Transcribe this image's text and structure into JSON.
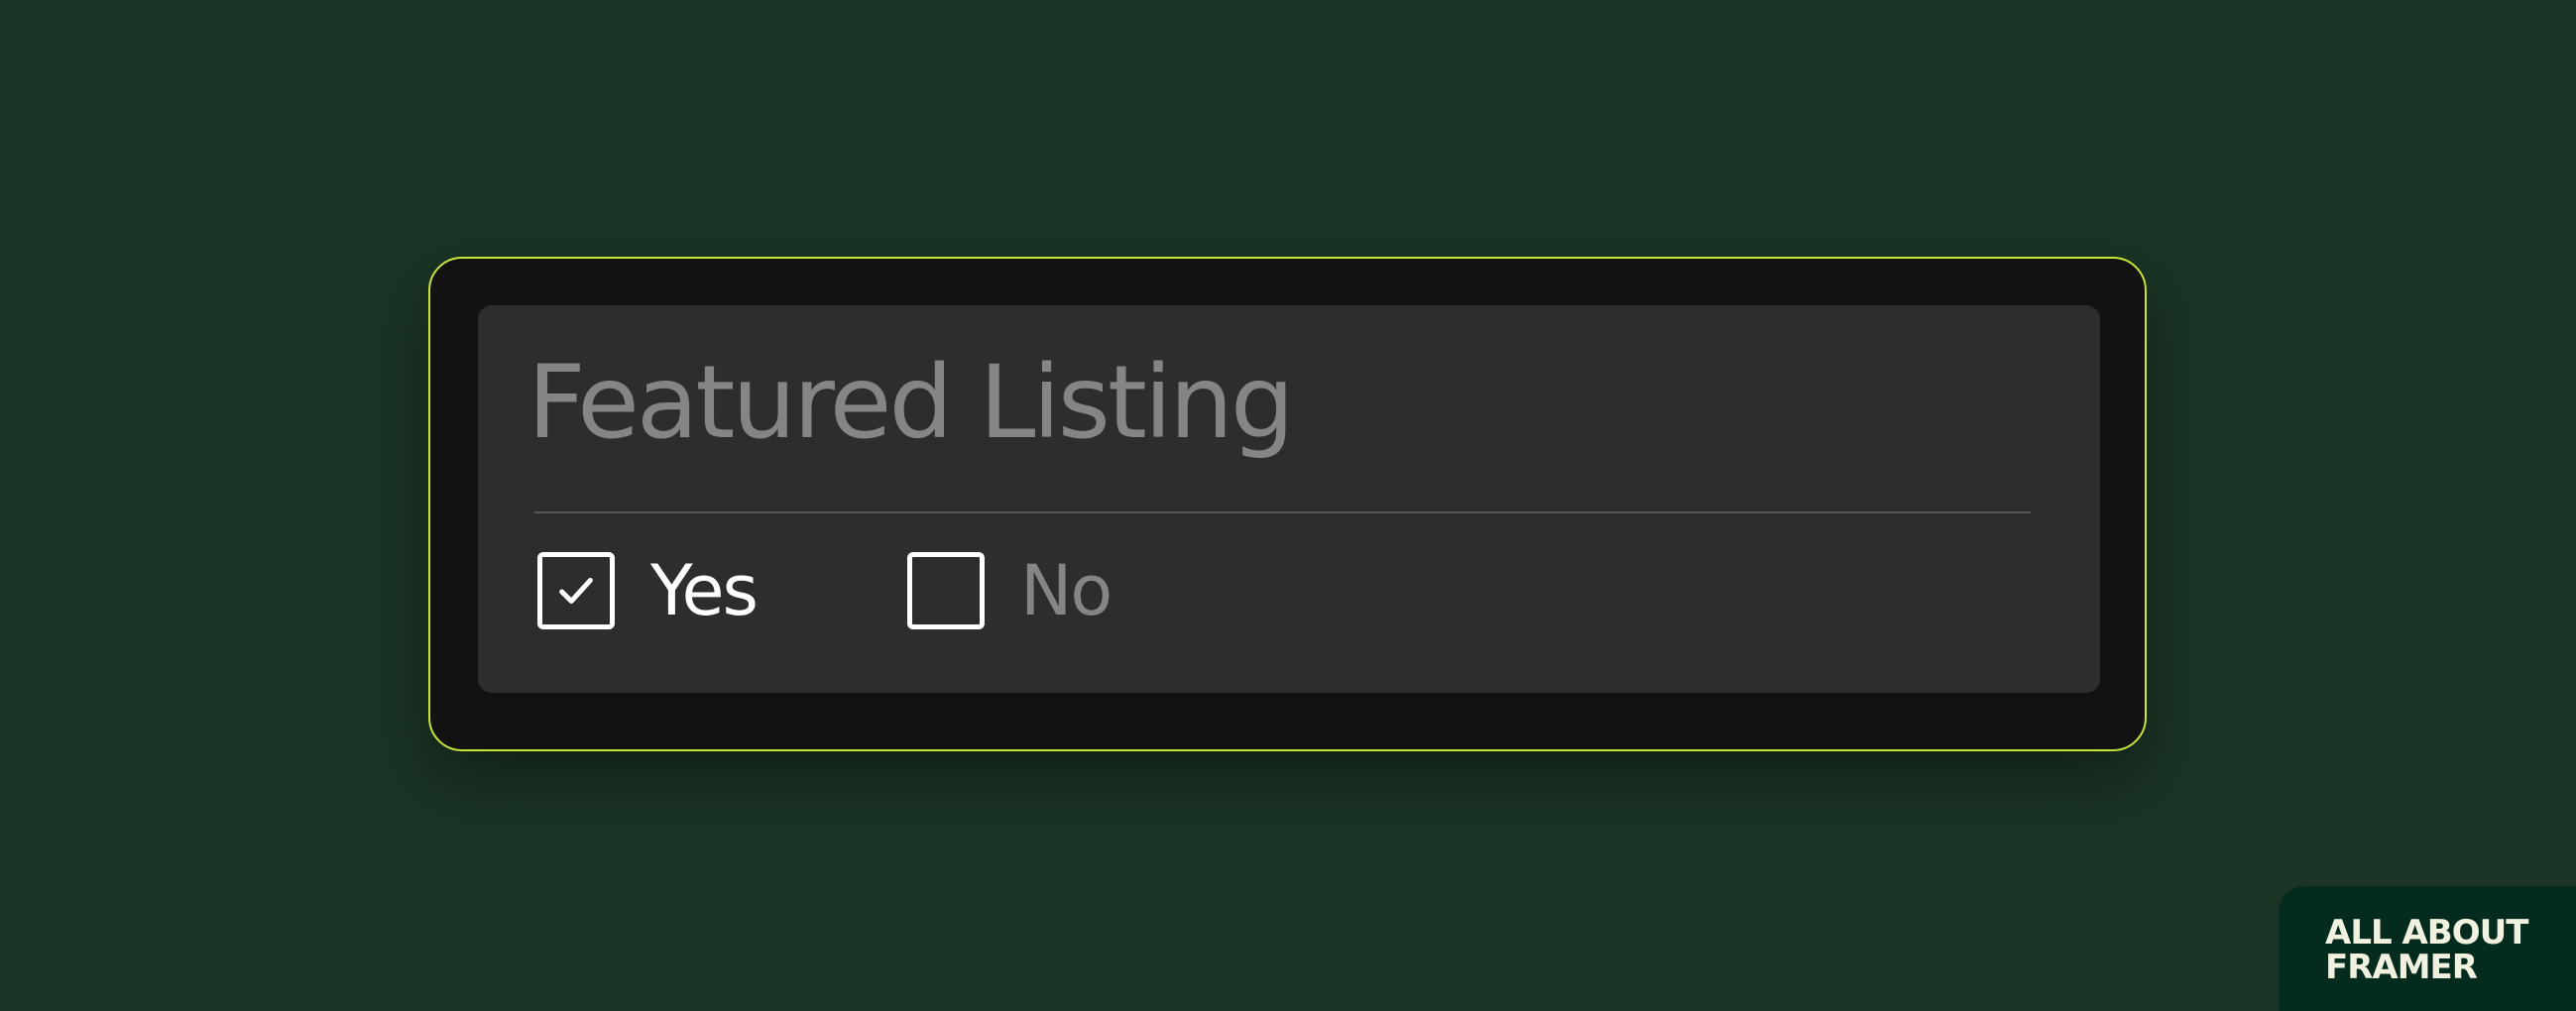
{
  "field": {
    "title": "Featured Listing",
    "options": [
      {
        "label": "Yes",
        "checked": true
      },
      {
        "label": "No",
        "checked": false
      }
    ]
  },
  "brand": {
    "line1": "ALL ABOUT",
    "line2": "FRAMER"
  },
  "colors": {
    "background": "#1b3425",
    "frame_border": "#c7e43a",
    "frame_fill": "#121212",
    "card_fill": "#2d2d2d",
    "muted_text": "#858585",
    "active_text": "#ffffff",
    "badge_fill": "#052a1e"
  },
  "icons": {
    "checked": "check-icon",
    "unchecked": "empty-box-icon"
  }
}
